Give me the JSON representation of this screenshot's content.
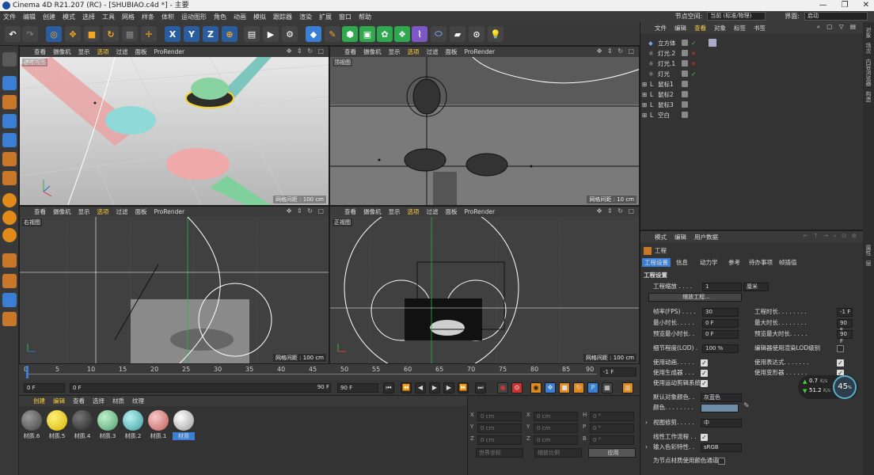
{
  "title": "Cinema 4D R21.207 (RC) - [SHUBIAO.c4d *] - 主要",
  "window_buttons": [
    "—",
    "❐",
    "✕"
  ],
  "menu": [
    "文件",
    "编辑",
    "创建",
    "模式",
    "选择",
    "工具",
    "网格",
    "样条",
    "体积",
    "运动图形",
    "角色",
    "动画",
    "模拟",
    "跟踪器",
    "渲染",
    "扩展",
    "窗口",
    "帮助"
  ],
  "node_space_label": "节点空间:",
  "node_space_value": "当前 (标准/物理)",
  "layout_label": "界面:",
  "layout_value": "启动",
  "viewport_menu": [
    "查看",
    "摄像机",
    "显示",
    "选项",
    "过滤",
    "面板",
    "ProRender"
  ],
  "viewports": [
    {
      "name": "透视视图",
      "grid": "网格间距 : 100 cm"
    },
    {
      "name": "顶视图",
      "grid": "网格间距 : 10 cm"
    },
    {
      "name": "右视图",
      "grid": "网格间距 : 100 cm"
    },
    {
      "name": "正视图",
      "grid": "网格间距 : 100 cm"
    }
  ],
  "timeline_ticks": [
    "0",
    "5",
    "10",
    "15",
    "20",
    "25",
    "30",
    "35",
    "40",
    "45",
    "50",
    "55",
    "60",
    "65",
    "70",
    "75",
    "80",
    "85",
    "90"
  ],
  "timeline_current": "-1 F",
  "transport": {
    "start": "0 F",
    "current": "0 F",
    "end": "90 F",
    "end2": "90 F"
  },
  "material_menu": [
    "创建",
    "编辑",
    "查看",
    "选择",
    "材质",
    "纹理"
  ],
  "materials": [
    {
      "name": "材质.6",
      "color": "#6a6a6a"
    },
    {
      "name": "材质.5",
      "color": "#f2d21c"
    },
    {
      "name": "材质.4",
      "color": "#3a3a3a"
    },
    {
      "name": "材质.3",
      "color": "#7fc79a"
    },
    {
      "name": "材质.2",
      "color": "#6cc7c9"
    },
    {
      "name": "材质.1",
      "color": "#e48e8e"
    },
    {
      "name": "材质",
      "color": "#d8d8d8"
    }
  ],
  "coords": {
    "rows": [
      {
        "a": "X",
        "av": "0 cm",
        "b": "X",
        "bv": "0 cm",
        "c": "H",
        "cv": "0 °"
      },
      {
        "a": "Y",
        "av": "0 cm",
        "b": "Y",
        "bv": "0 cm",
        "c": "P",
        "cv": "0 °"
      },
      {
        "a": "Z",
        "av": "0 cm",
        "b": "Z",
        "bv": "0 cm",
        "c": "B",
        "cv": "0 °"
      }
    ],
    "world": "世界坐标",
    "scale": "缩放比例",
    "apply": "应用"
  },
  "object_menu": [
    "文件",
    "编辑",
    "查看",
    "对象",
    "标签",
    "书签"
  ],
  "objects": [
    {
      "name": "立方体",
      "marks": "✓"
    },
    {
      "name": "灯光.2",
      "marks": "✕"
    },
    {
      "name": "灯光.1",
      "marks": "✕"
    },
    {
      "name": "灯光",
      "marks": "✓"
    },
    {
      "name": "鼠标1",
      "marks": ""
    },
    {
      "name": "鼠标2",
      "marks": ""
    },
    {
      "name": "鼠标3",
      "marks": ""
    },
    {
      "name": "空白",
      "marks": ""
    }
  ],
  "side_tabs": [
    "对象",
    "场次",
    "内容浏览器",
    "构造"
  ],
  "side_tabs_lower": [
    "属性",
    "层"
  ],
  "attr_menu": [
    "模式",
    "编辑",
    "用户数据"
  ],
  "attr_title": "工程",
  "attr_tabs": [
    "工程设置",
    "信息",
    "动力学",
    "参考",
    "待办事项",
    "帧插值"
  ],
  "attr_section": "工程设置",
  "project": {
    "scale_label": "工程缩放 . . . .",
    "scale_value": "1",
    "scale_unit": "厘米",
    "scale_button": "缩放工程...",
    "fps_label": "帧率(FPS) . . . .",
    "fps_value": "30",
    "duration_label": "工程时长. . . . . . . .",
    "duration_value": "-1 F",
    "min_label": "最小时长. . . . .",
    "min_value": "0 F",
    "max_label": "最大时长. . . . . . . .",
    "max_value": "90 F",
    "pmin_label": "预览最小时长. .",
    "pmin_value": "0 F",
    "pmax_label": "预览最大时长. . . . .",
    "pmax_value": "90 F",
    "lod_label": "细节程度(LOD) .",
    "lod_value": "100 %",
    "lod_check_label": "编辑器使用渲染LOD级别",
    "anim_label": "使用动画. . . . .",
    "expr_label": "使用表达式. . . . . . .",
    "gen_label": "使用生成器 . . .",
    "deform_label": "使用变形器 . . . . . .",
    "motion_label": "使用运动剪辑系统",
    "objcolor_label": "默认对象颜色. .",
    "objcolor_value": "灰蓝色",
    "color_label": "颜色. . . . . . . .",
    "view_clip_label": "视图修剪. . . . .",
    "view_clip_value": "中",
    "linear_label": "线性工作流程 . .",
    "input_color_label": "输入色彩特性. .",
    "input_color_value": "sRGB",
    "node_color_label": "为节点材质使用颜色通道"
  },
  "perf": {
    "up": "0.7",
    "down": "51.2",
    "unit": "K/s",
    "percent": "45",
    "pct_sign": "%"
  }
}
